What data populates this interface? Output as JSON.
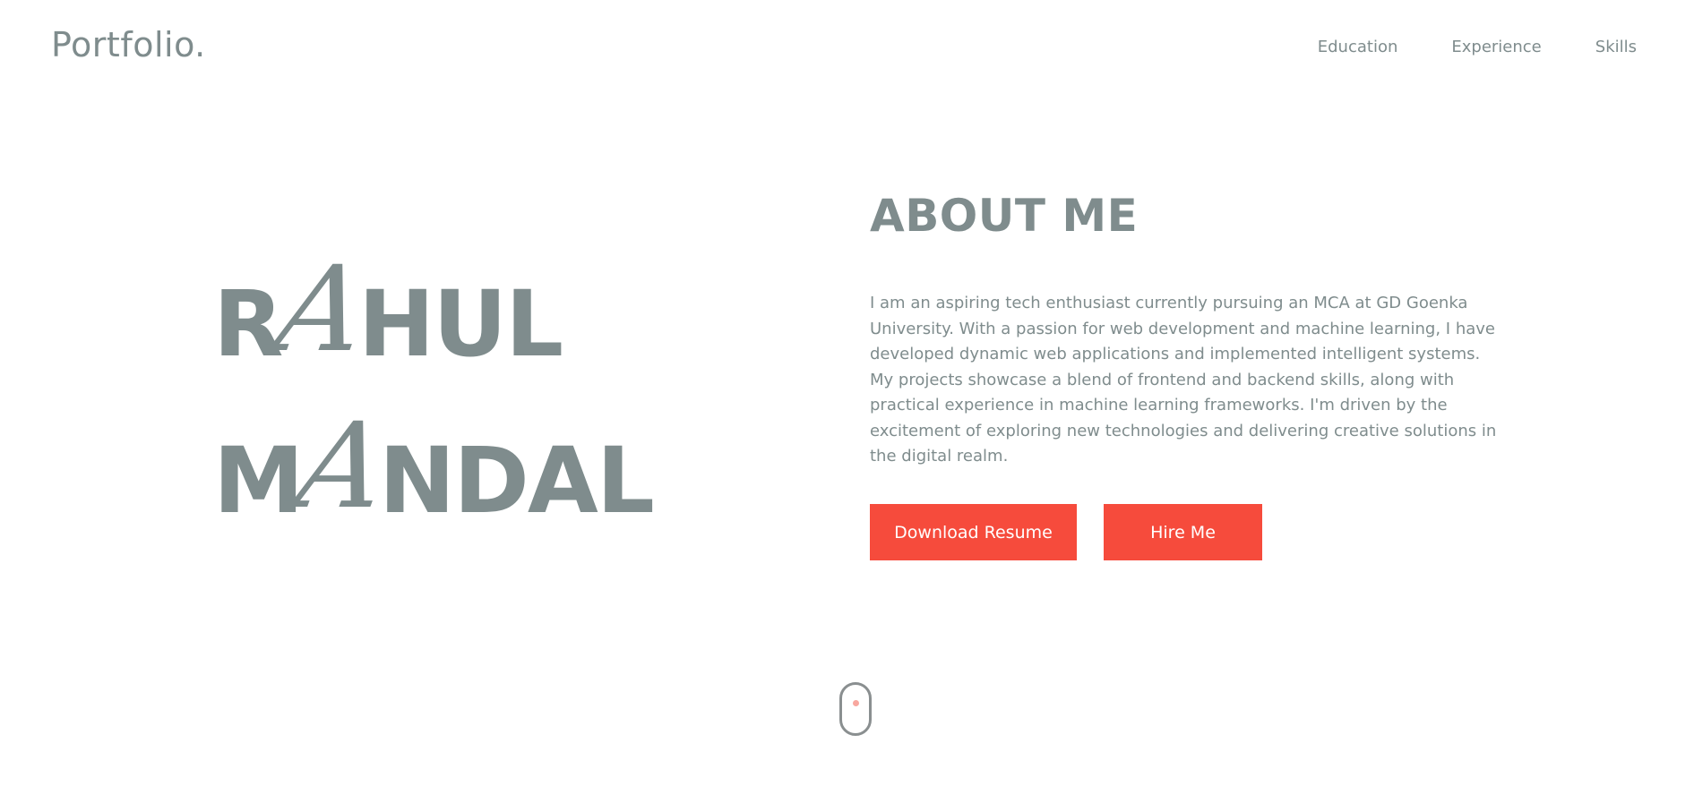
{
  "header": {
    "brand": "Portfolio.",
    "nav": [
      {
        "label": "Education"
      },
      {
        "label": "Experience"
      },
      {
        "label": "Skills"
      }
    ]
  },
  "hero": {
    "name_line1": {
      "before": "R",
      "script": "A",
      "after": "HUL"
    },
    "name_line2": {
      "before": "M",
      "script": "A",
      "after": "NDAL"
    }
  },
  "about": {
    "title": "ABOUT ME",
    "text": "I am an aspiring tech enthusiast currently pursuing an MCA at GD Goenka University. With a passion for web development and machine learning, I have developed dynamic web applications and implemented intelligent systems. My projects showcase a blend of frontend and backend skills, along with practical experience in machine learning frameworks. I'm driven by the excitement of exploring new technologies and delivering creative solutions in the digital realm.",
    "buttons": {
      "resume": "Download Resume",
      "hire": "Hire Me"
    }
  },
  "scroll_indicator": {
    "icon": "mouse-scroll-icon"
  },
  "colors": {
    "text": "#7f8c8d",
    "accent": "#f64b3c",
    "background": "#ffffff"
  }
}
